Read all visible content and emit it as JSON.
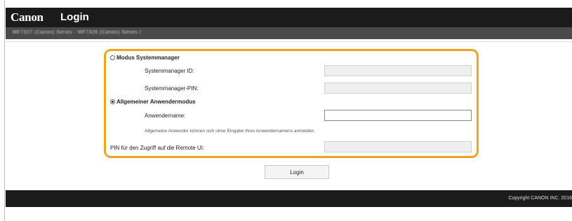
{
  "header": {
    "logo_text": "Canon",
    "title": "Login",
    "sub_info": "MF7327 (Canon) Series - MF7326 (Canon) Series /"
  },
  "form": {
    "system_manager_mode": {
      "label": "Modus Systemmanager",
      "selected": false,
      "id_label": "Systemmanager ID:",
      "id_value": "",
      "pin_label": "Systemmanager-PIN:",
      "pin_value": ""
    },
    "general_user_mode": {
      "label": "Allgemeiner Anwendermodus",
      "selected": true,
      "username_label": "Anwendername:",
      "username_value": "",
      "note": "Allgemeine Anwender können sich ohne Eingabe ihres Anwendernamens anmelden."
    },
    "remote_pin": {
      "label": "PIN für den Zugriff auf die Remote UI:",
      "value": ""
    },
    "login_button": "Login"
  },
  "footer": {
    "copyright": "Copyright CANON INC. 2016"
  },
  "colors": {
    "highlight": "#f2a222",
    "header_bg": "#1b1b1b"
  }
}
